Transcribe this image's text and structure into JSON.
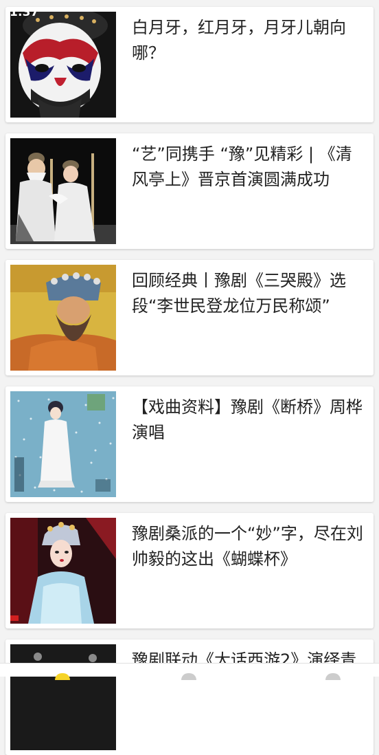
{
  "status_bar": {
    "time": "1:37"
  },
  "feed": {
    "items": [
      {
        "title": "白月牙，红月牙，月牙儿朝向哪？",
        "thumb_icon": "opera-mask-image"
      },
      {
        "title": "“艺”同携手 “豫”见精彩 | 《清风亭上》晋京首演圆满成功",
        "thumb_icon": "opera-stage-image"
      },
      {
        "title": "回顾经典丨豫剧《三哭殿》选段“李世民登龙位万民称颂”",
        "thumb_icon": "opera-emperor-image"
      },
      {
        "title": "【戏曲资料】豫剧《断桥》周桦 演唱",
        "thumb_icon": "opera-album-cover-image"
      },
      {
        "title": "豫剧桑派的一个“妙”字，尽在刘帅毅的这出《蝴蝶杯》",
        "thumb_icon": "opera-actress-image"
      },
      {
        "title": "豫剧联动《大话西游2》演绎青",
        "thumb_icon": "opera-performance-image"
      }
    ]
  },
  "bottom_nav": {
    "colors": {
      "first": "#f5d327",
      "second": "#cccccc",
      "third": "#cccccc"
    }
  }
}
